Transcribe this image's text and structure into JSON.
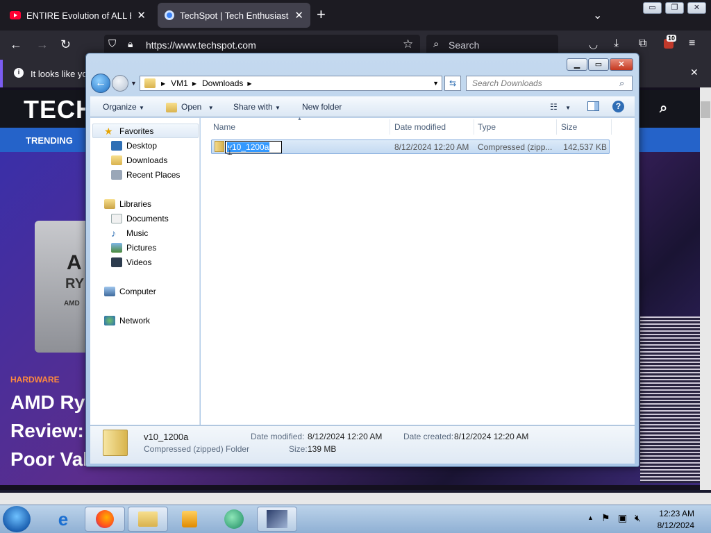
{
  "browser": {
    "tabs": [
      {
        "title": "ENTIRE Evolution of ALL Europe",
        "active": false
      },
      {
        "title": "TechSpot | Tech Enthusiasts, Po",
        "active": true
      }
    ],
    "url": "https://www.techspot.com",
    "search_placeholder": "Search",
    "extension_badge": "10",
    "info_text": "It looks like yo"
  },
  "site": {
    "logo": "TECH",
    "nav_trending": "TRENDING",
    "hero_chip_text_1": "A",
    "hero_chip_text_2": "RY",
    "hero_chip_text_3": "AMD",
    "category": "HARDWARE",
    "headline_lines": [
      "AMD Ryz",
      "Review:",
      "Poor Val"
    ]
  },
  "explorer": {
    "breadcrumb": [
      "VM1",
      "Downloads"
    ],
    "search_placeholder": "Search Downloads",
    "toolbar": {
      "organize": "Organize",
      "open": "Open",
      "share_with": "Share with",
      "new_folder": "New folder"
    },
    "nav": {
      "favorites": "Favorites",
      "desktop": "Desktop",
      "downloads": "Downloads",
      "recent_places": "Recent Places",
      "libraries": "Libraries",
      "documents": "Documents",
      "music": "Music",
      "pictures": "Pictures",
      "videos": "Videos",
      "computer": "Computer",
      "network": "Network"
    },
    "columns": {
      "name": "Name",
      "date_modified": "Date modified",
      "type": "Type",
      "size": "Size"
    },
    "file": {
      "name": "v10_1200a",
      "date_modified": "8/12/2024 12:20 AM",
      "type": "Compressed (zipp...",
      "size": "142,537 KB"
    },
    "details": {
      "name": "v10_1200a",
      "type": "Compressed (zipped) Folder",
      "date_modified_label": "Date modified:",
      "date_modified": "8/12/2024 12:20 AM",
      "date_created_label": "Date created:",
      "date_created": "8/12/2024 12:20 AM",
      "size_label": "Size:",
      "size": "139 MB"
    }
  },
  "taskbar": {
    "time": "12:23 AM",
    "date": "8/12/2024"
  },
  "colors": {
    "accent_blue": "#2563c9",
    "firefox_dark": "#1c1b22",
    "selection": "#3399ff"
  }
}
